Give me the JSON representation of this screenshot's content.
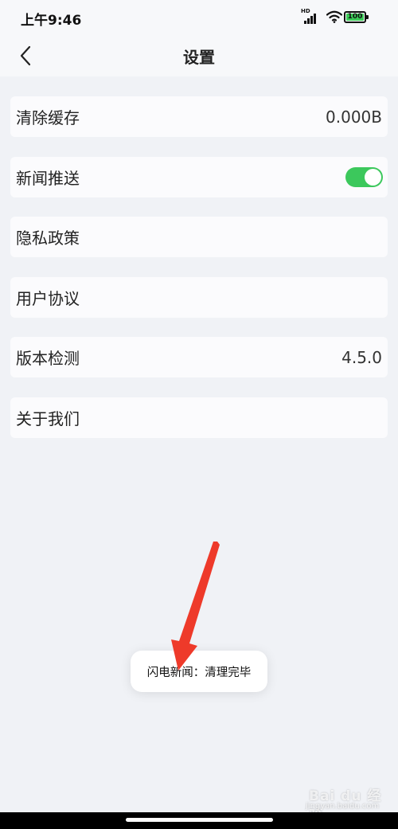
{
  "status_bar": {
    "time": "上午9:46",
    "signal_label": "HD",
    "battery_level": "100",
    "battery_color": "#3ccc58"
  },
  "header": {
    "title": "设置",
    "back_icon": "chevron-left-icon"
  },
  "settings": {
    "items": [
      {
        "label": "清除缓存",
        "value": "0.000B"
      },
      {
        "label": "新闻推送",
        "toggle_on": true
      },
      {
        "label": "隐私政策"
      },
      {
        "label": "用户协议"
      },
      {
        "label": "版本检测",
        "value": "4.5.0"
      },
      {
        "label": "关于我们"
      }
    ]
  },
  "toast": {
    "message": "闪电新闻：清理完毕"
  },
  "watermark": {
    "brand": "Bai du 经验",
    "url": "jingyan.baidu.com"
  },
  "colors": {
    "background": "#f0f2f6",
    "toggle_on": "#3cc85c",
    "annotation_arrow": "#ee3a2a"
  }
}
